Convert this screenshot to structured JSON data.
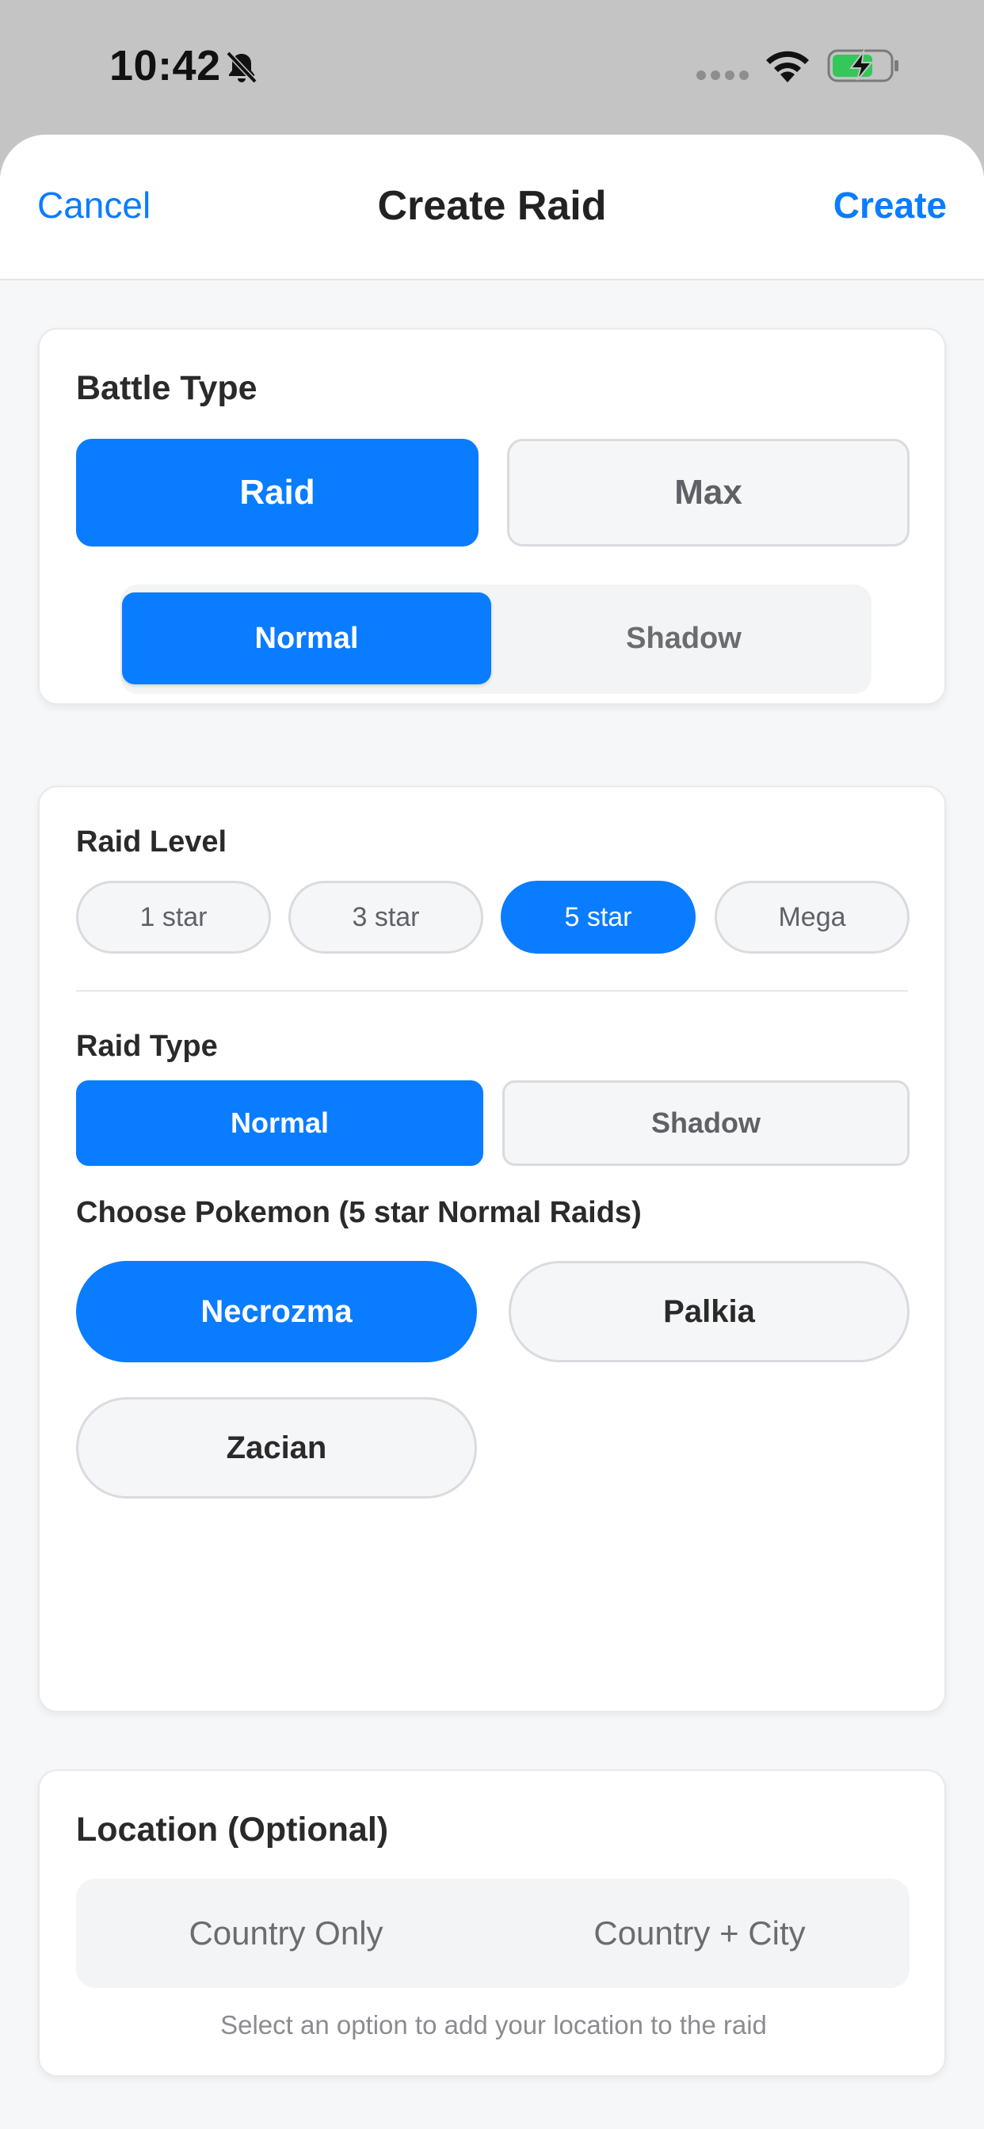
{
  "status": {
    "time": "10:42"
  },
  "nav": {
    "cancel": "Cancel",
    "title": "Create Raid",
    "create": "Create"
  },
  "battle_type": {
    "title": "Battle Type",
    "options": [
      "Raid",
      "Max"
    ],
    "selected": "Raid",
    "sub_options": [
      "Normal",
      "Shadow"
    ],
    "sub_selected": "Normal"
  },
  "raid_level": {
    "label": "Raid Level",
    "options": [
      "1 star",
      "3 star",
      "5 star",
      "Mega"
    ],
    "selected": "5 star"
  },
  "raid_type": {
    "label": "Raid Type",
    "options": [
      "Normal",
      "Shadow"
    ],
    "selected": "Normal"
  },
  "pokemon": {
    "label": "Choose Pokemon (5 star Normal Raids)",
    "options": [
      "Necrozma",
      "Palkia",
      "Zacian"
    ],
    "selected": "Necrozma"
  },
  "location": {
    "title": "Location (Optional)",
    "options": [
      "Country Only",
      "Country + City"
    ],
    "hint": "Select an option to add your location to the raid"
  },
  "colors": {
    "accent": "#0a7cff",
    "battery_fill": "#34c759"
  }
}
